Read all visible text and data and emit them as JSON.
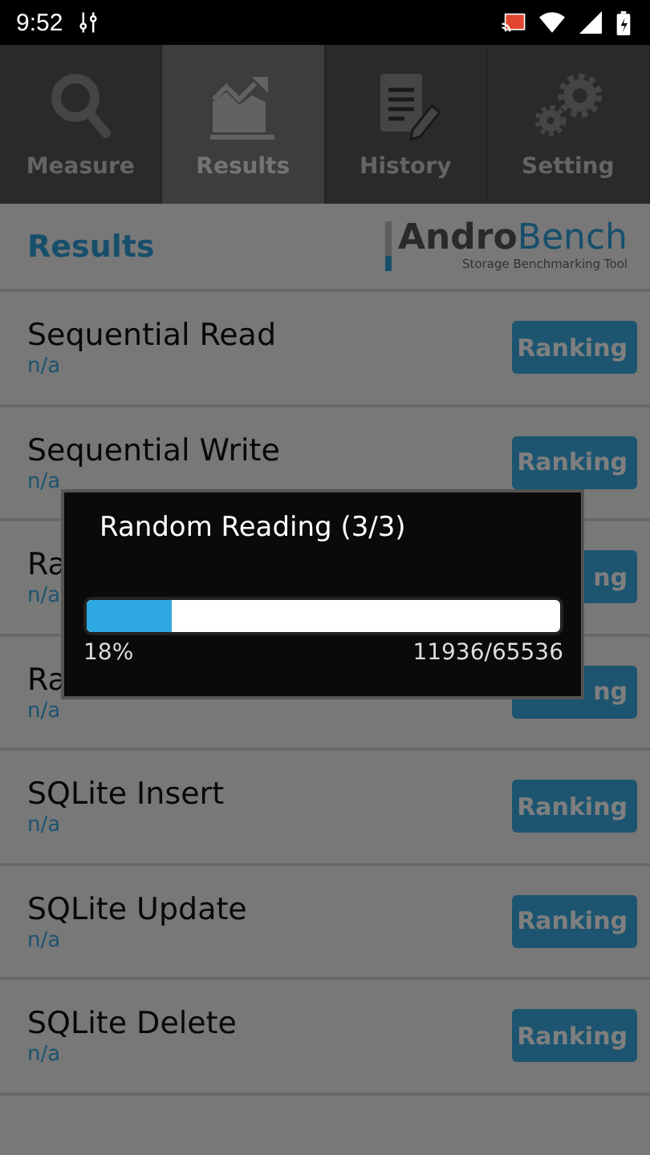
{
  "status_bar": {
    "time": "9:52"
  },
  "tabs": [
    {
      "label": "Measure",
      "kind": "search",
      "selected": false
    },
    {
      "label": "Results",
      "kind": "chart",
      "selected": true
    },
    {
      "label": "History",
      "kind": "document",
      "selected": false
    },
    {
      "label": "Setting",
      "kind": "gears",
      "selected": false
    }
  ],
  "header": {
    "title": "Results",
    "logo": "**Andro**Bench",
    "tagline": "Storage Benchmarking Tool"
  },
  "tests": [
    {
      "name": "Sequential Read",
      "result": "n/a",
      "button": "Ranking"
    },
    {
      "name": "Sequential Write",
      "result": "n/a",
      "button": "Ranking"
    },
    {
      "name": "Ra",
      "result": "n/a",
      "button": "ng"
    },
    {
      "name": "Ra",
      "result": "n/a",
      "button": "ng"
    },
    {
      "name": "SQLite Insert",
      "result": "n/a",
      "button": "Ranking"
    },
    {
      "name": "SQLite Update",
      "result": "n/a",
      "button": "Ranking"
    },
    {
      "name": "SQLite Delete",
      "result": "n/a",
      "button": "Ranking"
    }
  ],
  "dialog": {
    "title": "Random Reading (3/3)",
    "level": 0.18,
    "percent": "18%",
    "count": "11936/65536"
  }
}
